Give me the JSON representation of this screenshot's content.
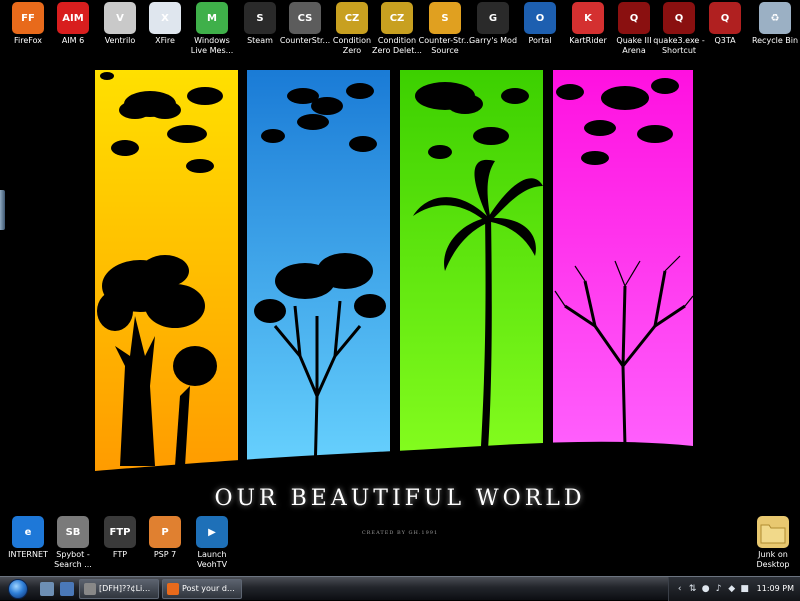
{
  "desktop_icons_top": [
    {
      "label": "FireFox",
      "icon": "firefox-icon",
      "color": "#e86a1b",
      "glyph": "FF"
    },
    {
      "label": "AIM 6",
      "icon": "aim-icon",
      "color": "#d81e1e",
      "glyph": "AIM"
    },
    {
      "label": "Ventrilo",
      "icon": "ventrilo-icon",
      "color": "#c9c9c9",
      "glyph": "V"
    },
    {
      "label": "XFire",
      "icon": "xfire-icon",
      "color": "#dfe6ee",
      "glyph": "X"
    },
    {
      "label": "Windows Live Mes...",
      "icon": "msn-icon",
      "color": "#3fb04a",
      "glyph": "M"
    },
    {
      "label": "Steam",
      "icon": "steam-icon",
      "color": "#2a2a2a",
      "glyph": "S"
    },
    {
      "label": "CounterStr...",
      "icon": "counterstrike-icon",
      "color": "#5c5c5c",
      "glyph": "CS"
    },
    {
      "label": "Condition Zero",
      "icon": "condition-zero-icon",
      "color": "#c8a020",
      "glyph": "CZ"
    },
    {
      "label": "Condition Zero Delet...",
      "icon": "condition-zero-deleted-icon",
      "color": "#c8a020",
      "glyph": "CZ"
    },
    {
      "label": "Counter-Str... Source",
      "icon": "cs-source-icon",
      "color": "#e0a020",
      "glyph": "S"
    },
    {
      "label": "Garry's Mod",
      "icon": "garrysmod-icon",
      "color": "#2a2a2a",
      "glyph": "G"
    },
    {
      "label": "Portal",
      "icon": "portal-icon",
      "color": "#1d5fb0",
      "glyph": "O"
    },
    {
      "label": "KartRider",
      "icon": "kartrider-icon",
      "color": "#d43030",
      "glyph": "K"
    },
    {
      "label": "Quake III Arena",
      "icon": "quake3-icon",
      "color": "#8a1010",
      "glyph": "Q"
    },
    {
      "label": "quake3.exe - Shortcut",
      "icon": "quake3-exe-icon",
      "color": "#8a1010",
      "glyph": "Q"
    },
    {
      "label": "Q3TA",
      "icon": "q3ta-icon",
      "color": "#b02020",
      "glyph": "Q"
    },
    {
      "label": "Recycle Bin",
      "icon": "recycle-bin-icon",
      "color": "#9bb0c4",
      "glyph": "♻"
    }
  ],
  "desktop_icons_bottom": [
    {
      "label": "INTERNET",
      "icon": "internet-explorer-icon",
      "color": "#1e78d8",
      "glyph": "e"
    },
    {
      "label": "Spybot - Search ...",
      "icon": "spybot-icon",
      "color": "#7a7a7a",
      "glyph": "SB"
    },
    {
      "label": "FTP",
      "icon": "ftp-icon",
      "color": "#3a3a3a",
      "glyph": "FTP"
    },
    {
      "label": "PSP 7",
      "icon": "psp-icon",
      "color": "#e08030",
      "glyph": "P"
    },
    {
      "label": "Launch VeohTV",
      "icon": "veohtv-icon",
      "color": "#1e70b8",
      "glyph": "▶"
    }
  ],
  "desktop_icon_right": {
    "label": "Junk on Desktop",
    "icon": "folder-icon",
    "color": "#e8c870",
    "glyph": ""
  },
  "wallpaper": {
    "title": "OUR BEAUTIFUL WORLD",
    "credit": "CREATED BY GH.1991"
  },
  "taskbar": {
    "tasks": [
      {
        "label": "[DFH]??¢Lime(Co.Id...",
        "icon": "task-window-icon",
        "color": "#888888"
      },
      {
        "label": "Post your desktop - ...",
        "icon": "task-firefox-icon",
        "color": "#e86a1b"
      }
    ],
    "clock": "11:09 PM"
  }
}
